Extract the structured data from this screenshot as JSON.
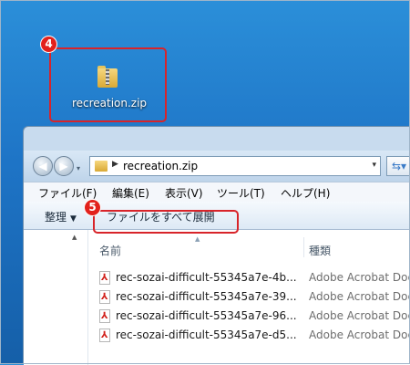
{
  "desktop": {
    "icon_label": "recreation.zip",
    "icon": "zip-folder-icon",
    "callouts": [
      {
        "number": "4",
        "target": "desktop-icon"
      },
      {
        "number": "5",
        "target": "extract-all-button"
      }
    ]
  },
  "window": {
    "nav": {
      "back": "◀",
      "forward": "▶",
      "history": "▾",
      "refresh_icon": "⇆▾"
    },
    "address": {
      "arrow": "▶",
      "path": "recreation.zip",
      "dropdown": "▾"
    },
    "menu": [
      "ファイル(F)",
      "編集(E)",
      "表示(V)",
      "ツール(T)",
      "ヘルプ(H)"
    ],
    "toolbar": {
      "organize": "整理",
      "organize_caret": "▼",
      "extract_all": "ファイルをすべて展開"
    },
    "columns": {
      "name": "名前",
      "type": "種類",
      "sort_caret": "▲",
      "scroll_up": "▲"
    },
    "files": [
      {
        "name": "rec-sozai-difficult-55345a7e-4b...",
        "type": "Adobe Acrobat Doc"
      },
      {
        "name": "rec-sozai-difficult-55345a7e-39...",
        "type": "Adobe Acrobat Doc"
      },
      {
        "name": "rec-sozai-difficult-55345a7e-96...",
        "type": "Adobe Acrobat Doc"
      },
      {
        "name": "rec-sozai-difficult-55345a7e-d5...",
        "type": "Adobe Acrobat Doc"
      }
    ]
  },
  "colors": {
    "callout": "#d8242a",
    "desktop": "#1e74c6",
    "pdf": "#d1201a"
  }
}
